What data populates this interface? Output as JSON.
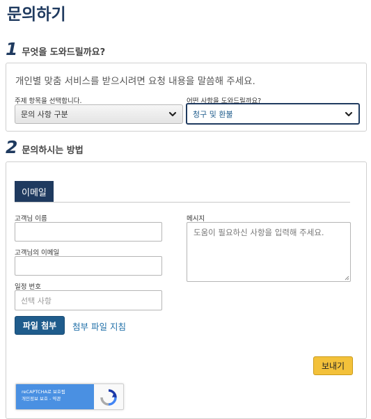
{
  "page": {
    "title": "문의하기"
  },
  "step1": {
    "number": "1",
    "label": "무엇을 도와드릴까요?",
    "intro": "개인별 맞춤 서비스를 받으시려면 요청 내용을 말씀해 주세요.",
    "topic_label": "주제 항목을 선택합니다.",
    "topic_value": "문의 사항 구분",
    "help_label": "어떤 사항을 도와드릴까요?",
    "help_value": "청구 및 환불"
  },
  "step2": {
    "number": "2",
    "label": "문의하시는 방법",
    "tab": "이메일",
    "name_label": "고객님 이름",
    "name_value": "",
    "email_label": "고객님의 이메일",
    "email_value": "",
    "itinerary_label": "일정 번호",
    "itinerary_placeholder": "선택 사항",
    "message_label": "메시지",
    "message_placeholder": "도움이 필요하신 사항을 입력해 주세요.",
    "attach_button": "파일 첨부",
    "attach_guide": "첨부 파일 지침",
    "send_button": "보내기"
  },
  "recaptcha": {
    "line1": "reCAPTCHA로 보호됨",
    "line2": "개인정보 보호 - 약관",
    "icon": "recaptcha-icon"
  },
  "colors": {
    "brand_navy": "#1f3a5f",
    "button_blue": "#1f5c8c",
    "send_yellow": "#f3c13a",
    "link_blue": "#1f6fa8"
  }
}
